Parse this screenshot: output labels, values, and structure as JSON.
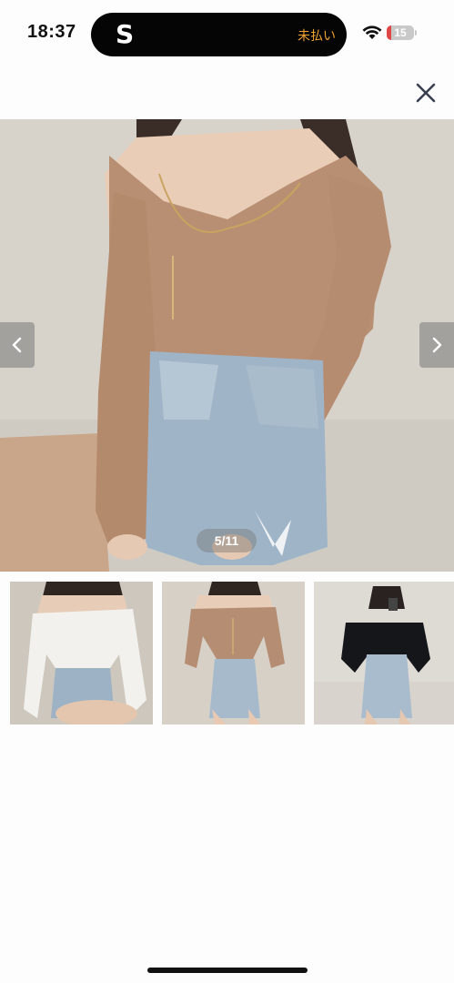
{
  "status_bar": {
    "time": "18:37",
    "app_icon_letter": "S",
    "island_label": "未払い",
    "battery_level": "15",
    "battery_fraction": 0.15,
    "battery_color": "#e04848"
  },
  "gallery": {
    "counter": "5/11",
    "current_index": 5,
    "total": 11,
    "close_icon": "close-icon",
    "prev_icon": "chevron-left-icon",
    "next_icon": "chevron-right-icon"
  },
  "thumbnails": [
    {
      "name": "white-top-photo",
      "shirt_color": "#f2f1ee"
    },
    {
      "name": "beige-top-photo",
      "shirt_color": "#b58d72"
    },
    {
      "name": "black-top-photo",
      "shirt_color": "#15161a"
    }
  ]
}
